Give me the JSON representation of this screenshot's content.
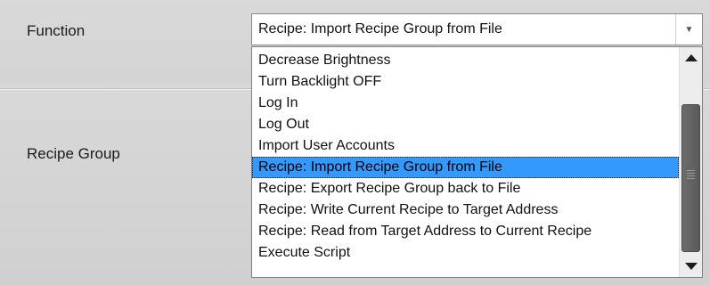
{
  "form": {
    "function_label": "Function",
    "recipe_group_label": "Recipe Group"
  },
  "combo": {
    "value": "Recipe: Import Recipe Group from File",
    "arrow_icon": "chevron-down-icon"
  },
  "dropdown": {
    "items": [
      "Decrease Brightness",
      "Turn Backlight OFF",
      "Log In",
      "Log Out",
      "Import User Accounts",
      "Recipe: Import Recipe Group from File",
      "Recipe: Export Recipe Group back to File",
      "Recipe: Write Current Recipe to Target Address",
      "Recipe: Read from Target Address to Current Recipe",
      "Execute Script"
    ],
    "selected_index": 5
  },
  "colors": {
    "selection": "#3399ff",
    "scroll_thumb": "#606060",
    "background": "#d4d4d4"
  }
}
